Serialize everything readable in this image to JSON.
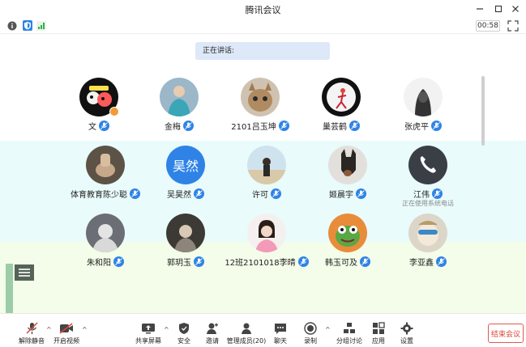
{
  "window": {
    "title": "腾讯会议"
  },
  "status": {
    "timer": "00:58"
  },
  "speaking_label": "正在讲话:",
  "participants": [
    {
      "name": "文",
      "avatar": "cartoon-sticker"
    },
    {
      "name": "金梅",
      "avatar": "person-photo"
    },
    {
      "name": "2101吕玉坤",
      "avatar": "cat-photo"
    },
    {
      "name": "巢芸鹤",
      "avatar": "sketch-figure"
    },
    {
      "name": "张虎平",
      "avatar": "hooded-figure"
    },
    {
      "name": "体育教育陈少聪",
      "avatar": "hand-photo"
    },
    {
      "name": "吴昊然",
      "avatar_text": "昊然"
    },
    {
      "name": "许可",
      "avatar": "person-photo"
    },
    {
      "name": "姬晨宇",
      "avatar": "dog-photo"
    },
    {
      "name": "江伟",
      "avatar": "phone-icon",
      "subnote": "正在使用系统电话"
    },
    {
      "name": "朱和阳",
      "avatar": "person-photo"
    },
    {
      "name": "郭玥玉",
      "avatar": "person-photo"
    },
    {
      "name": "12班2101018李晴",
      "avatar": "girl-photo"
    },
    {
      "name": "韩玉可及",
      "avatar": "frog-photo"
    },
    {
      "name": "李亚鑫",
      "avatar": "character-photo"
    }
  ],
  "toolbar": {
    "unmute": "解除静音",
    "video": "开启视频",
    "share": "共享屏幕",
    "security": "安全",
    "invite": "邀请",
    "members": "管理成员(20)",
    "chat": "聊天",
    "record": "录制",
    "breakout": "分组讨论",
    "apps": "应用",
    "settings": "设置",
    "end": "结束会议"
  },
  "colors": {
    "accent": "#2f83e6",
    "end": "#d8463a",
    "speaking_bg": "#dde8f8"
  }
}
